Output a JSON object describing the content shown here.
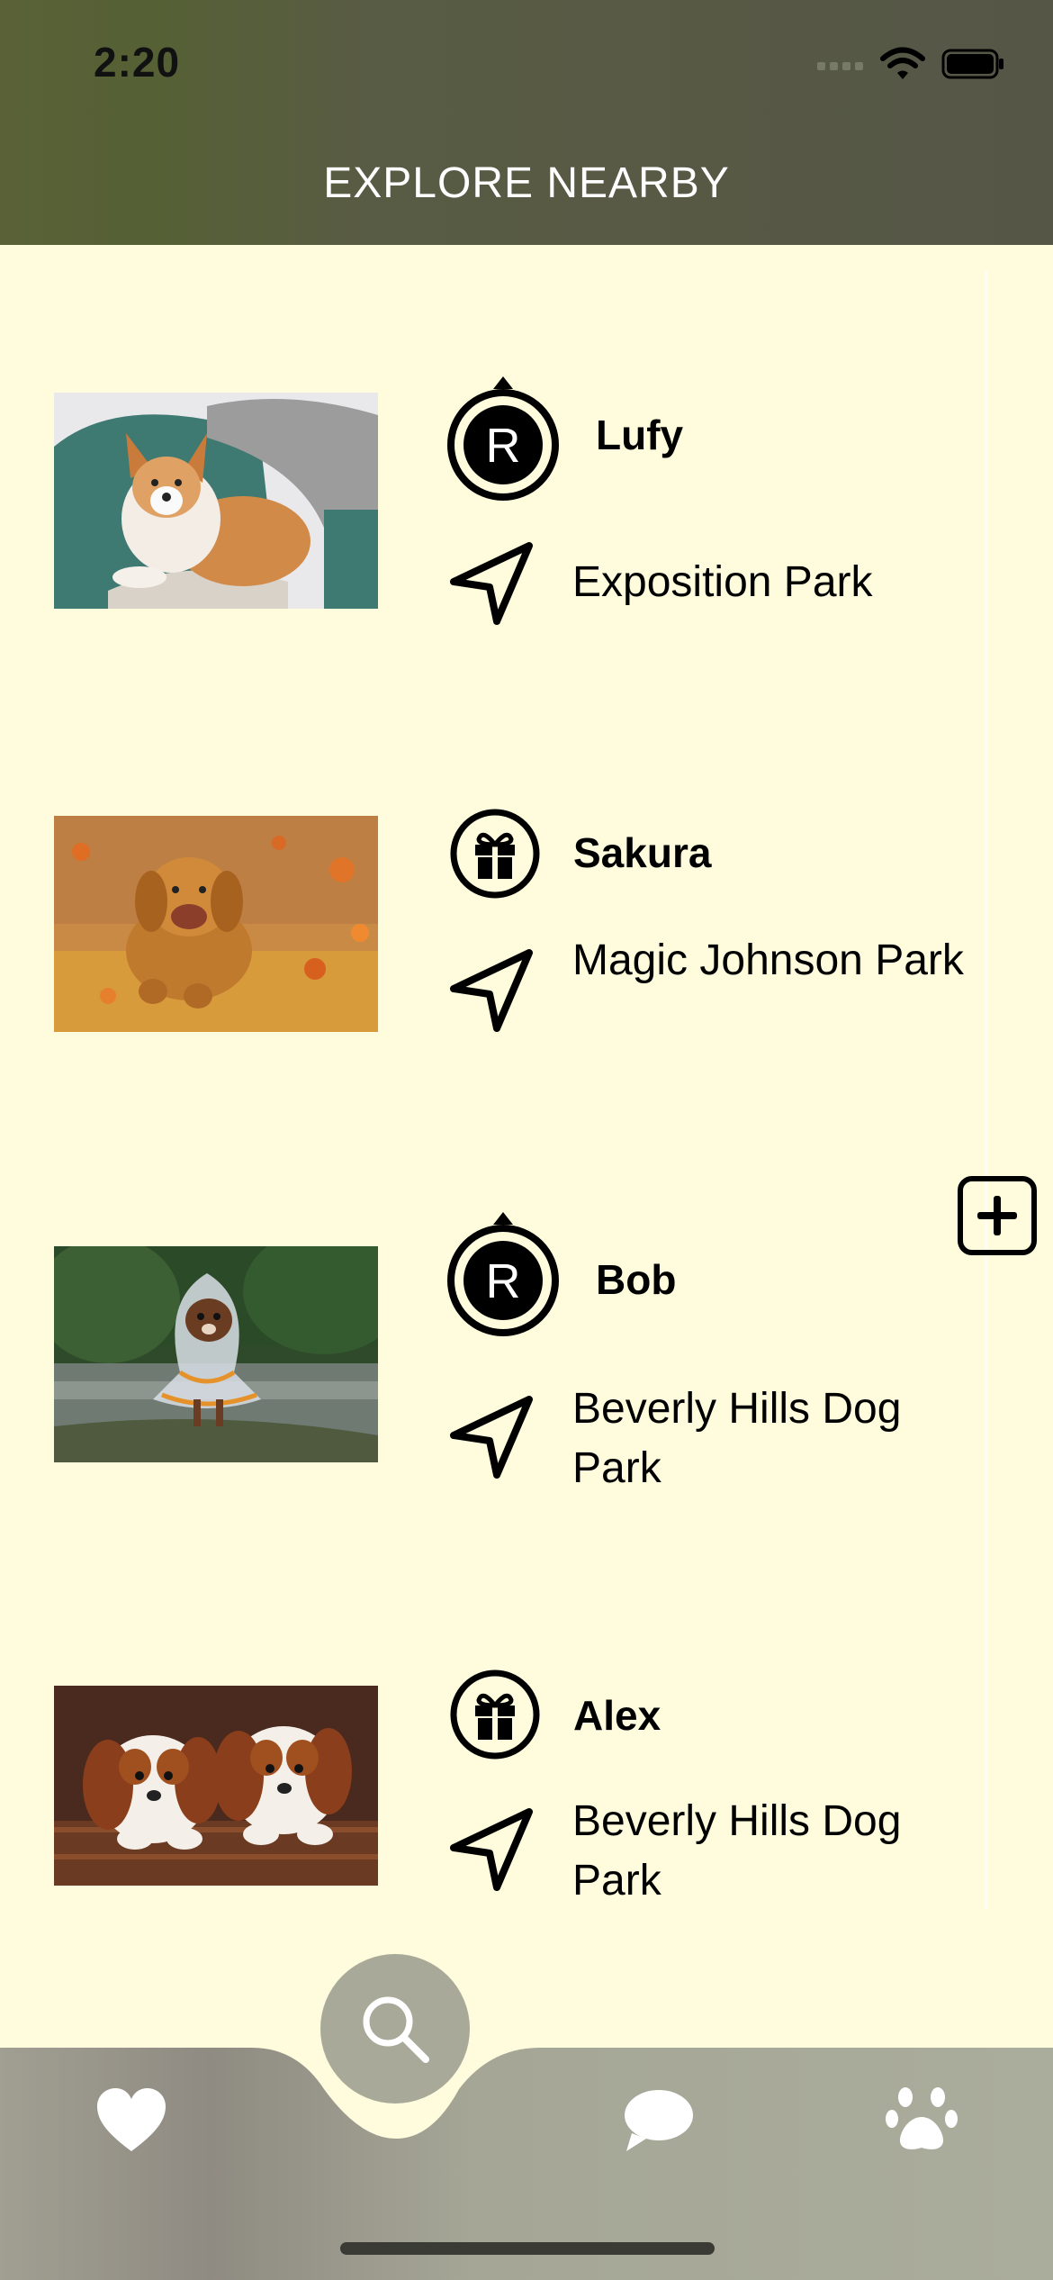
{
  "status_bar": {
    "time": "2:20"
  },
  "header": {
    "title": "EXPLORE NEARBY"
  },
  "colors": {
    "background": "#fefcdc",
    "header": "#565a40",
    "tabbar": "#a5a696",
    "fab": "#a8a998"
  },
  "pets": [
    {
      "name": "Lufy",
      "badge_icon": "registered-circle-icon",
      "location": "Exposition Park",
      "photo": "corgi-on-green-sofa"
    },
    {
      "name": "Sakura",
      "badge_icon": "gift-circle-icon",
      "location": "Magic Johnson Park",
      "photo": "golden-retriever-running-autumn-leaves"
    },
    {
      "name": "Bob",
      "badge_icon": "registered-circle-icon",
      "location": "Beverly Hills Dog Park",
      "photo": "chihuahua-in-raincoat"
    },
    {
      "name": "Alex",
      "badge_icon": "gift-circle-icon",
      "location": "Beverly Hills Dog Park",
      "photo": "two-cavalier-puppies-in-basket"
    }
  ],
  "tabbar": {
    "tabs": [
      {
        "icon": "heart-icon"
      },
      {
        "icon": "search-icon",
        "selected": true
      },
      {
        "icon": "chat-bubble-icon"
      },
      {
        "icon": "paw-icon"
      }
    ]
  }
}
